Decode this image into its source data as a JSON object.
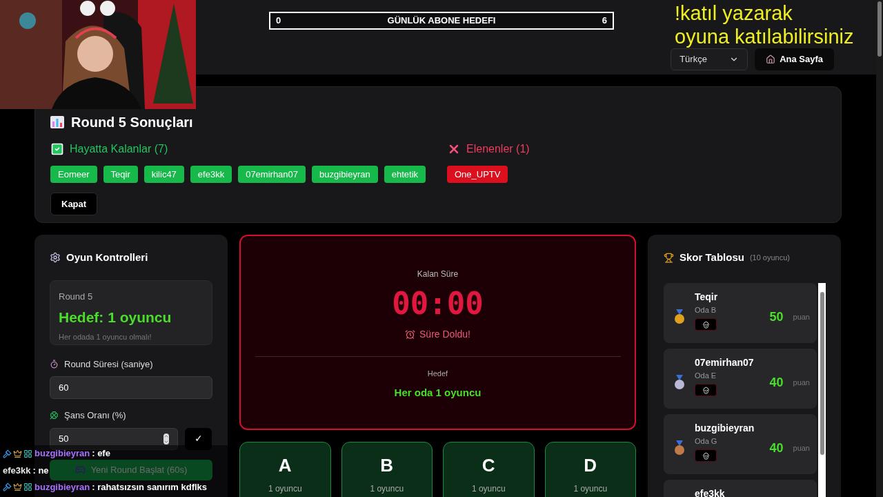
{
  "goal_bar": {
    "start": "0",
    "title": "GÜNLÜK ABONE HEDEFI",
    "end": "6"
  },
  "stream_notice": [
    "!katıl yazarak",
    "oyuna katılabilirsiniz"
  ],
  "header": {
    "language": "Türkçe",
    "home_button": "Ana Sayfa"
  },
  "results": {
    "title": "Round 5 Sonuçları",
    "survivors": {
      "title": "Hayatta Kalanlar (7)",
      "players": [
        "Eomeer",
        "Teqir",
        "kilic47",
        "efe3kk",
        "07emirhan07",
        "buzgibieyran",
        "ehtetik"
      ]
    },
    "eliminated": {
      "title": "Elenenler (1)",
      "players": [
        "One_UPTV"
      ]
    },
    "close_button": "Kapat"
  },
  "controls": {
    "title": "Oyun Kontrolleri",
    "round": {
      "label": "Round 5",
      "target": "Hedef: 1 oyuncu",
      "note": "Her odada 1 oyuncu olmalı!"
    },
    "duration": {
      "label": "Round Süresi (saniye)",
      "value": "60"
    },
    "chance": {
      "label": "Şans Oranı (%)",
      "value": "50",
      "confirm": "✓"
    },
    "start_button": "Yeni Round Başlat (60s)"
  },
  "timer": {
    "label": "Kalan Süre",
    "time": "00:00",
    "status": "Süre Doldu!",
    "target_label": "Hedef",
    "target": "Her oda 1 oyuncu"
  },
  "rooms": [
    {
      "letter": "A",
      "count": "1 oyuncu"
    },
    {
      "letter": "B",
      "count": "1 oyuncu"
    },
    {
      "letter": "C",
      "count": "1 oyuncu"
    },
    {
      "letter": "D",
      "count": "1 oyuncu"
    }
  ],
  "scoreboard": {
    "title": "Skor Tablosu",
    "count": "(10 oyuncu)",
    "entries": [
      {
        "name": "Teqir",
        "room": "Oda B",
        "score": "50",
        "unit": "puan",
        "color": "#e0a020"
      },
      {
        "name": "07emirhan07",
        "room": "Oda E",
        "score": "40",
        "unit": "puan",
        "color": "#b8b8d8"
      },
      {
        "name": "buzgibieyran",
        "room": "Oda G",
        "score": "40",
        "unit": "puan",
        "color": "#c07a4a"
      },
      {
        "name": "efe3kk"
      }
    ]
  },
  "chat": [
    {
      "user": "buzgibieyran",
      "message": ": efe",
      "color": "#a970ff",
      "badges": true
    },
    {
      "user": "efe3kk",
      "message": ": ne",
      "color": "#e8e8e8",
      "badges": false
    },
    {
      "user": "buzgibieyran",
      "message": ": rahatsızsın sanırım kdflks",
      "color": "#a970ff",
      "badges": true
    }
  ]
}
